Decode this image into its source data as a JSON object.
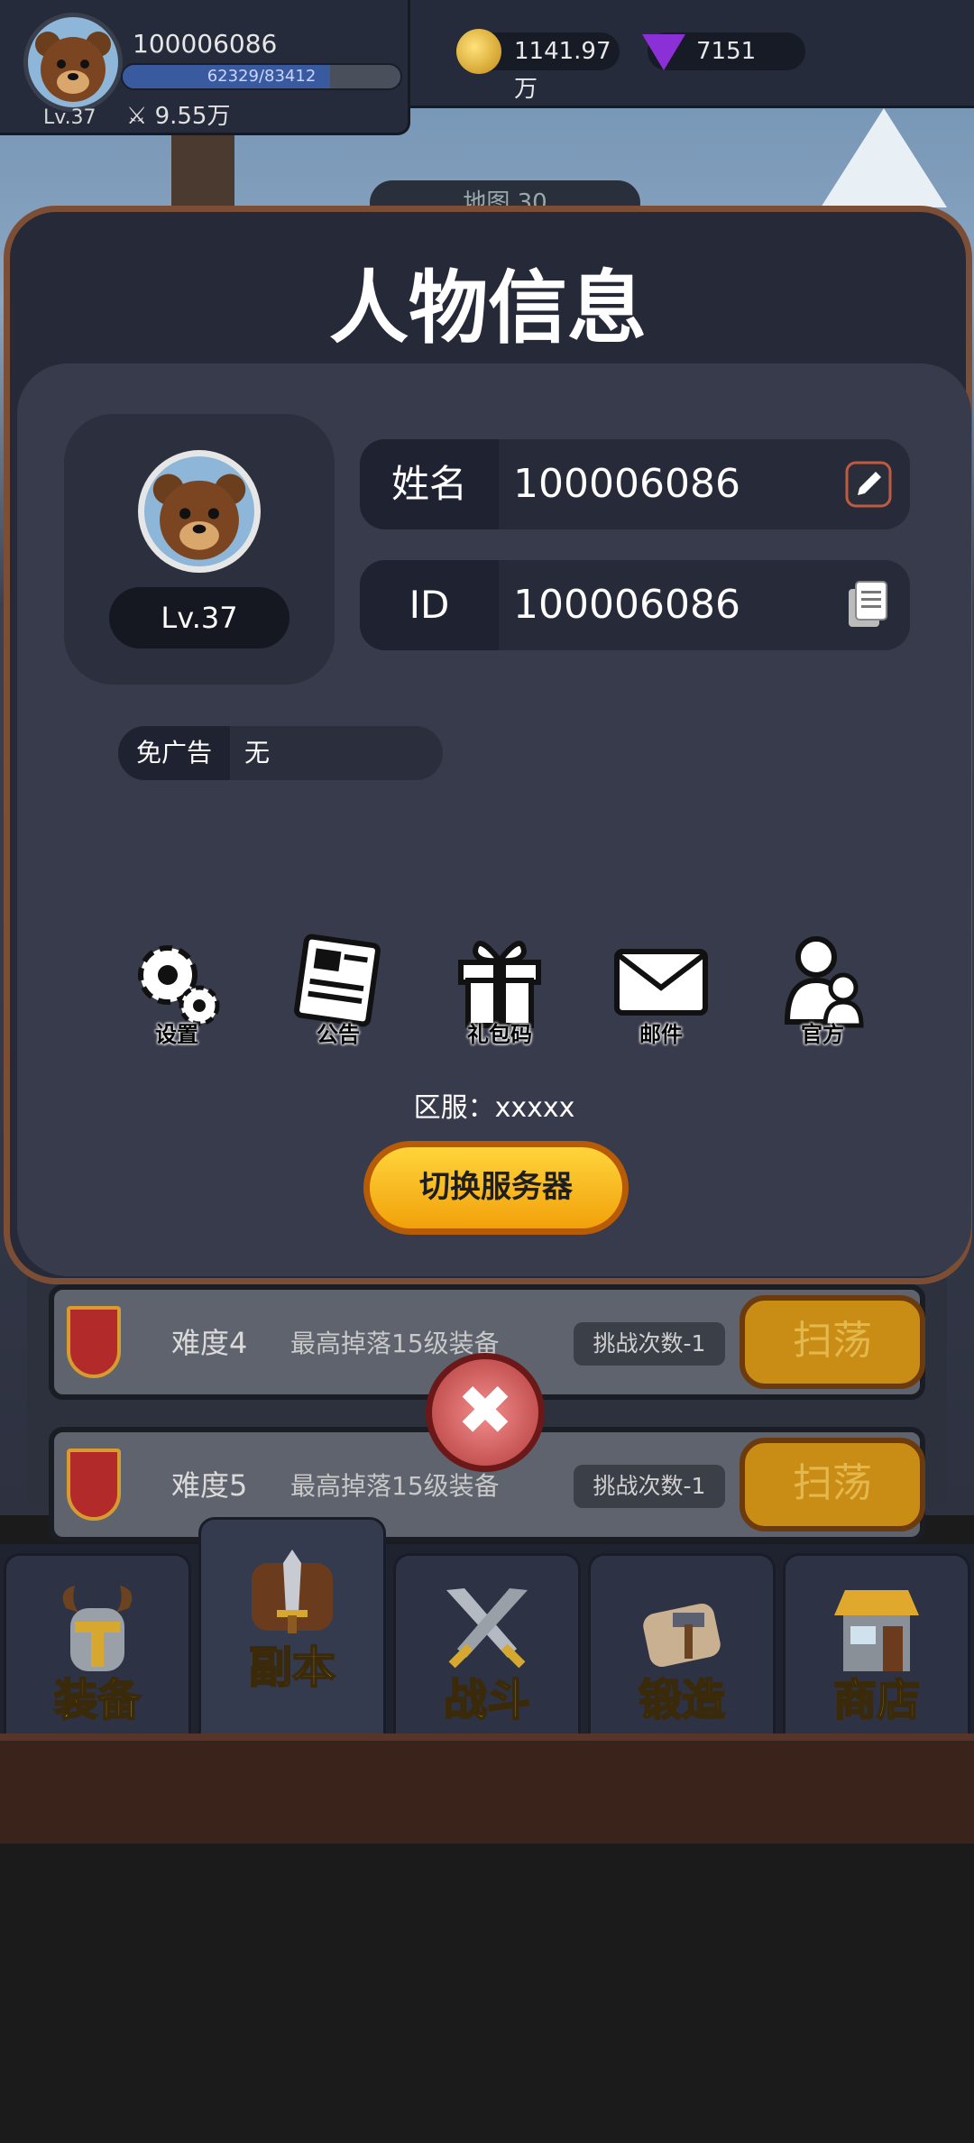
{
  "top_bar": {
    "username": "100006086",
    "level": "Lv.37",
    "exp_text": "62329/83412",
    "exp_fraction": 0.747,
    "power": "9.55万",
    "gold": "1141.97万",
    "gems": "7151"
  },
  "background": {
    "map_label": "地图 30",
    "dungeon_rows": [
      {
        "difficulty": "难度4",
        "drop": "最高掉落15级装备",
        "count": "挑战次数-1",
        "button": "扫荡"
      },
      {
        "difficulty": "难度5",
        "drop": "最高掉落15级装备",
        "count": "挑战次数-1",
        "button": "扫荡"
      }
    ]
  },
  "modal": {
    "title": "人物信息",
    "level": "Lv.37",
    "name_label": "姓名",
    "name_value": "100006086",
    "id_label": "ID",
    "id_value": "100006086",
    "adfree_label": "免广告",
    "adfree_value": "无",
    "actions": [
      {
        "label": "设置",
        "icon": "gear-icon"
      },
      {
        "label": "公告",
        "icon": "newspaper-icon"
      },
      {
        "label": "礼包码",
        "icon": "gift-icon"
      },
      {
        "label": "邮件",
        "icon": "mail-icon"
      },
      {
        "label": "官方",
        "icon": "people-icon"
      }
    ],
    "server_text": "区服：xxxxx",
    "switch_button": "切换服务器"
  },
  "bottom_nav": [
    {
      "label": "装备",
      "icon": "helmet-icon"
    },
    {
      "label": "副本",
      "icon": "sword-shield-icon"
    },
    {
      "label": "战斗",
      "icon": "crossed-swords-icon"
    },
    {
      "label": "锻造",
      "icon": "anvil-scroll-icon"
    },
    {
      "label": "商店",
      "icon": "shop-icon"
    }
  ],
  "colors": {
    "modal_border": "#7d4e36",
    "modal_bg": "#262a38",
    "button_yellow": "#ffd43b",
    "nav_label": "#d7a830"
  }
}
